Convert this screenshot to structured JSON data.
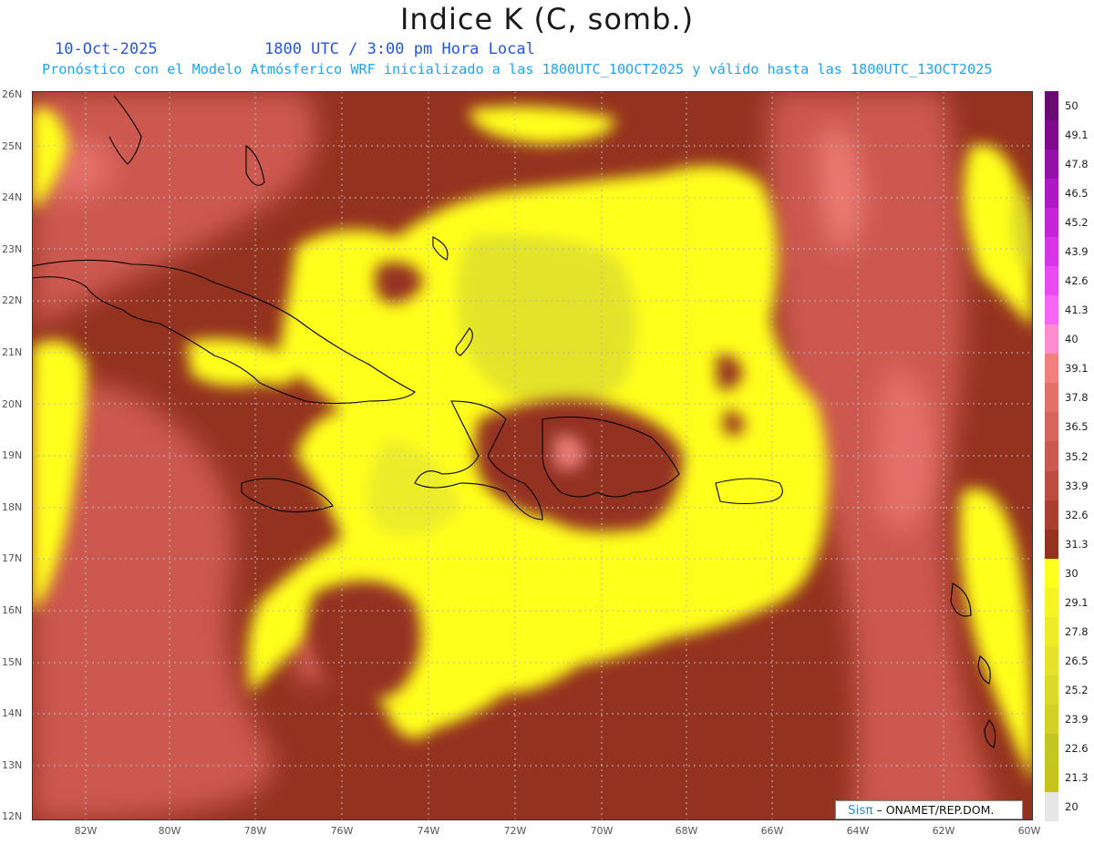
{
  "header": {
    "title": "Indice K (C, somb.)",
    "date": "10-Oct-2025",
    "time": "1800 UTC / 3:00 pm Hora Local",
    "subtitle": "Pronóstico con el Modelo Atmósferico WRF inicializado a las 1800UTC_10OCT2025 y válido hasta las  1800UTC_13OCT2025"
  },
  "axes": {
    "latitudes": [
      "26N",
      "25N",
      "24N",
      "23N",
      "22N",
      "21N",
      "20N",
      "19N",
      "18N",
      "17N",
      "16N",
      "15N",
      "14N",
      "13N",
      "12N"
    ],
    "longitudes": [
      "82W",
      "80W",
      "78W",
      "76W",
      "74W",
      "72W",
      "70W",
      "68W",
      "66W",
      "64W",
      "62W",
      "60W"
    ]
  },
  "colorbar": {
    "labels": [
      "50",
      "49.1",
      "47.8",
      "46.5",
      "45.2",
      "43.9",
      "42.6",
      "41.3",
      "40",
      "39.1",
      "37.8",
      "36.5",
      "35.2",
      "33.9",
      "32.6",
      "31.3",
      "30",
      "29.1",
      "27.8",
      "26.5",
      "25.2",
      "23.9",
      "22.6",
      "21.3",
      "20"
    ],
    "colors": [
      "#6a0a73",
      "#7d0a8c",
      "#9510a8",
      "#ad18c2",
      "#c424d6",
      "#d835e6",
      "#e84bf0",
      "#f466f5",
      "#ff8ccf",
      "#f0807d",
      "#e47169",
      "#d8655b",
      "#cc594f",
      "#bc4c40",
      "#a9402f",
      "#943220",
      "#ffff1e",
      "#f6f424",
      "#ecec29",
      "#e3e32c",
      "#dada2a",
      "#d0d026",
      "#c6c622",
      "#c4c41c",
      "#e6e6e6"
    ]
  },
  "credit": {
    "logo": "Sisπ",
    "text": "– ONAMET/REP.DOM."
  }
}
